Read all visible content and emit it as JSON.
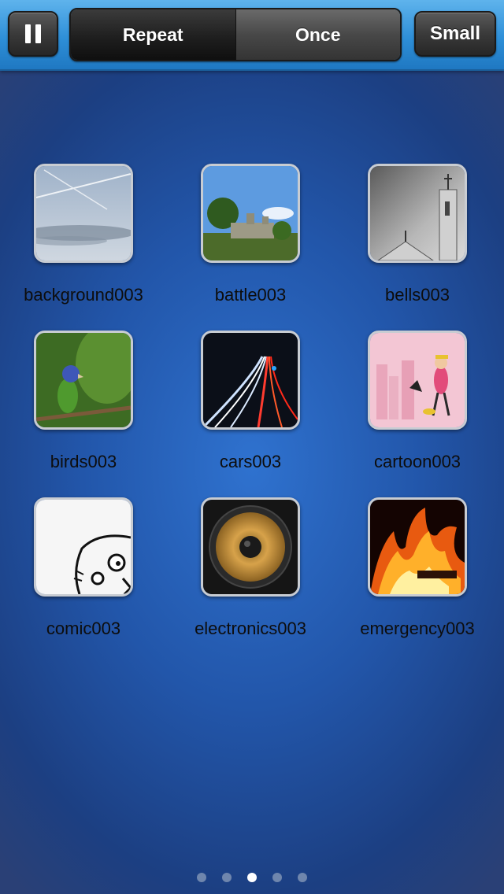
{
  "toolbar": {
    "pause_icon": "pause-icon",
    "segment": [
      {
        "label": "Repeat",
        "selected": true
      },
      {
        "label": "Once",
        "selected": false
      }
    ],
    "size_label": "Small"
  },
  "sounds": [
    {
      "label": "background003"
    },
    {
      "label": "battle003"
    },
    {
      "label": "bells003"
    },
    {
      "label": "birds003"
    },
    {
      "label": "cars003"
    },
    {
      "label": "cartoon003"
    },
    {
      "label": "comic003"
    },
    {
      "label": "electronics003"
    },
    {
      "label": "emergency003"
    }
  ],
  "pager": {
    "page_count": 5,
    "current_page": 3
  }
}
